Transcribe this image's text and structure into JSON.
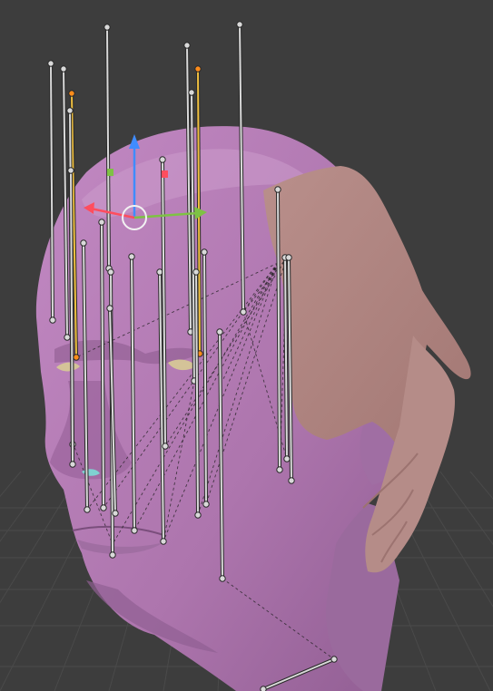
{
  "app": {
    "name": "3D viewport",
    "background_color": "#3d3d3d",
    "grid_color": "#4a4a4a"
  },
  "scene": {
    "head": {
      "skin_color": "#b07ab0",
      "skin_shadow_color": "#8f5c92",
      "hair_color": "#b48a87",
      "hair_edge_color": "#9a716e",
      "eye_color": "#cdbc8f"
    },
    "armature": {
      "bone_color": "#d9d9d9",
      "bone_selected_color": "#f0c040",
      "bone_active_tip_color": "#ff8c1a",
      "relationship_line_style": "dashed",
      "bone_count": 26
    },
    "gizmo": {
      "x_axis_color": "#ff4d5e",
      "y_axis_color": "#7ec244",
      "z_axis_color": "#3f8cff",
      "center_icon": "circle-icon"
    }
  }
}
